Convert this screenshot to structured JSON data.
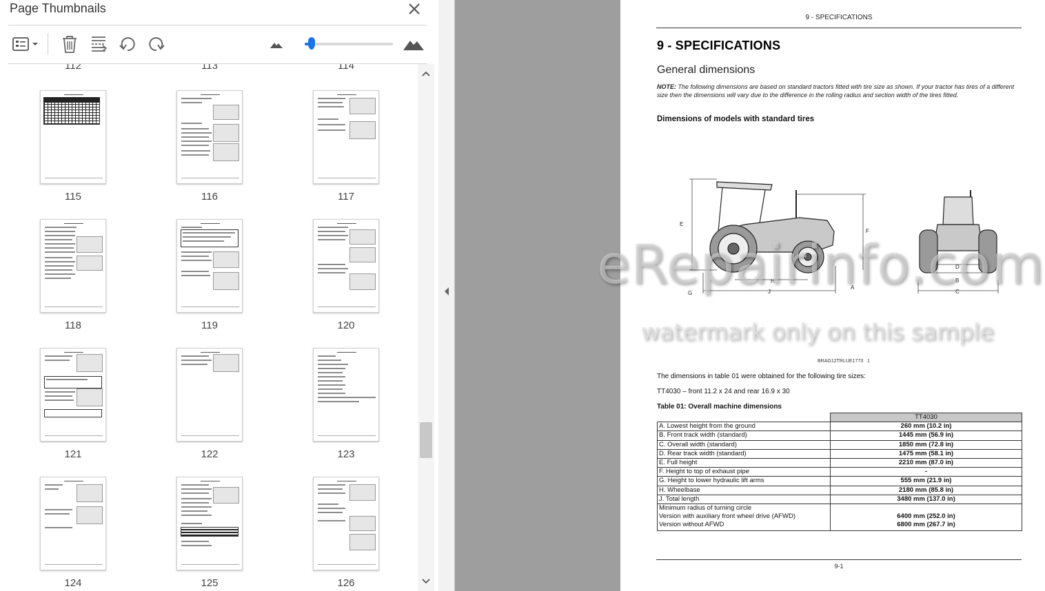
{
  "panel": {
    "title": "Page Thumbnails",
    "partial_pages": [
      "112",
      "113",
      "114"
    ],
    "thumbnails": [
      {
        "page": "115"
      },
      {
        "page": "116"
      },
      {
        "page": "117"
      },
      {
        "page": "118"
      },
      {
        "page": "119"
      },
      {
        "page": "120"
      },
      {
        "page": "121"
      },
      {
        "page": "122"
      },
      {
        "page": "123"
      },
      {
        "page": "124"
      },
      {
        "page": "125"
      },
      {
        "page": "126"
      }
    ],
    "zoom_fraction": 0.08
  },
  "toolbar": {
    "icons": [
      "thumbnail-options-icon",
      "delete-icon",
      "extract-icon",
      "rotate-left-icon",
      "rotate-right-icon",
      "zoom-out-mountain-icon",
      "zoom-in-mountain-icon"
    ]
  },
  "document": {
    "header": "9 - SPECIFICATIONS",
    "title": "9 - SPECIFICATIONS",
    "subtitle": "General dimensions",
    "note_label": "NOTE:",
    "note_text": "The following dimensions are based on standard tractors fitted with tire size as shown.  If your tractor has tires of a different size then the dimensions will vary due to the difference in the rolling radius and section width of the tires fitted.",
    "section_heading": "Dimensions of models with standard tires",
    "figure_ref": "BRAG12TRLUE1773",
    "figure_num": "1",
    "figure_letters": {
      "A": "A",
      "B": "B",
      "C": "C",
      "D": "D",
      "E": "E",
      "F": "F",
      "G": "G",
      "H": "H",
      "J": "J"
    },
    "para1": "The dimensions in table 01 were obtained for the following tire sizes:",
    "para2": "TT4030 – front 11.2 x 24 and rear 16.9 x 30",
    "table_caption": "Table 01:  Overall machine dimensions",
    "table_header": "TT4030",
    "rows": [
      {
        "name": "A.  Lowest height from the ground",
        "value": "260 mm (10.2 in)"
      },
      {
        "name": "B.  Front track width (standard)",
        "value": "1445 mm (56.9 in)"
      },
      {
        "name": "C.  Overall width (standard)",
        "value": "1850 mm (72.8 in)"
      },
      {
        "name": "D.  Rear track width (standard)",
        "value": "1475 mm (58.1 in)"
      },
      {
        "name": "E.  Full height",
        "value": "2210 mm (87.0 in)"
      },
      {
        "name": "F.  Height to top of exhaust pipe",
        "value": "-"
      },
      {
        "name": "G.  Height to lower hydraulic lift arms",
        "value": "555 mm (21.9 in)"
      },
      {
        "name": "H.  Wheelbase",
        "value": "2180 mm (85.8 in)"
      },
      {
        "name": "J.  Total length",
        "value": "3480 mm (137.0 in)"
      }
    ],
    "turning": {
      "line1": "Minimum radius of turning circle",
      "line2": "Version with auxiliary front wheel drive (AFWD)",
      "line3": "Version without AFWD",
      "value2": "6400 mm (252.0 in)",
      "value3": "6800 mm (267.7 in)"
    },
    "footer": "9-1"
  },
  "watermark": {
    "main": "eRepairinfo.com",
    "sub": "watermark only on this sample"
  }
}
